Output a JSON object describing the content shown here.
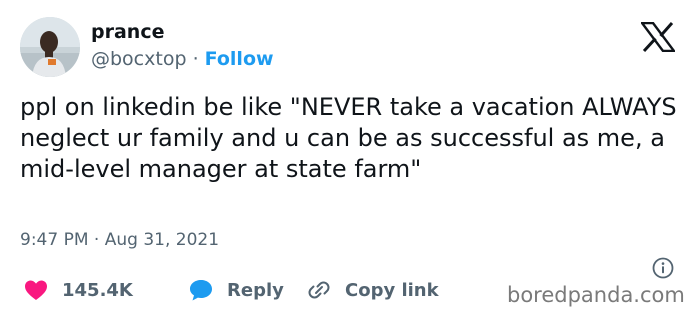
{
  "author": {
    "display_name": "prance",
    "handle": "@bocxtop",
    "separator": "·",
    "follow_label": "Follow"
  },
  "tweet": {
    "text": "ppl on linkedin be like \"NEVER take a vacation ALWAYS neglect ur family and u can be as successful as me, a mid-level manager at state farm\"",
    "time": "9:47 PM",
    "separator": "·",
    "date": "Aug 31, 2021"
  },
  "actions": {
    "likes_count": "145.4K",
    "reply_label": "Reply",
    "copy_link_label": "Copy link"
  },
  "watermark": "boredpanda.com",
  "icons": {
    "logo": "x-logo-icon",
    "info": "info-icon",
    "like": "heart-icon",
    "reply": "speech-bubble-icon",
    "copy": "link-icon"
  },
  "colors": {
    "text": "#0f1419",
    "secondary": "#536471",
    "accent": "#1d9bf0",
    "like": "#f91880"
  }
}
